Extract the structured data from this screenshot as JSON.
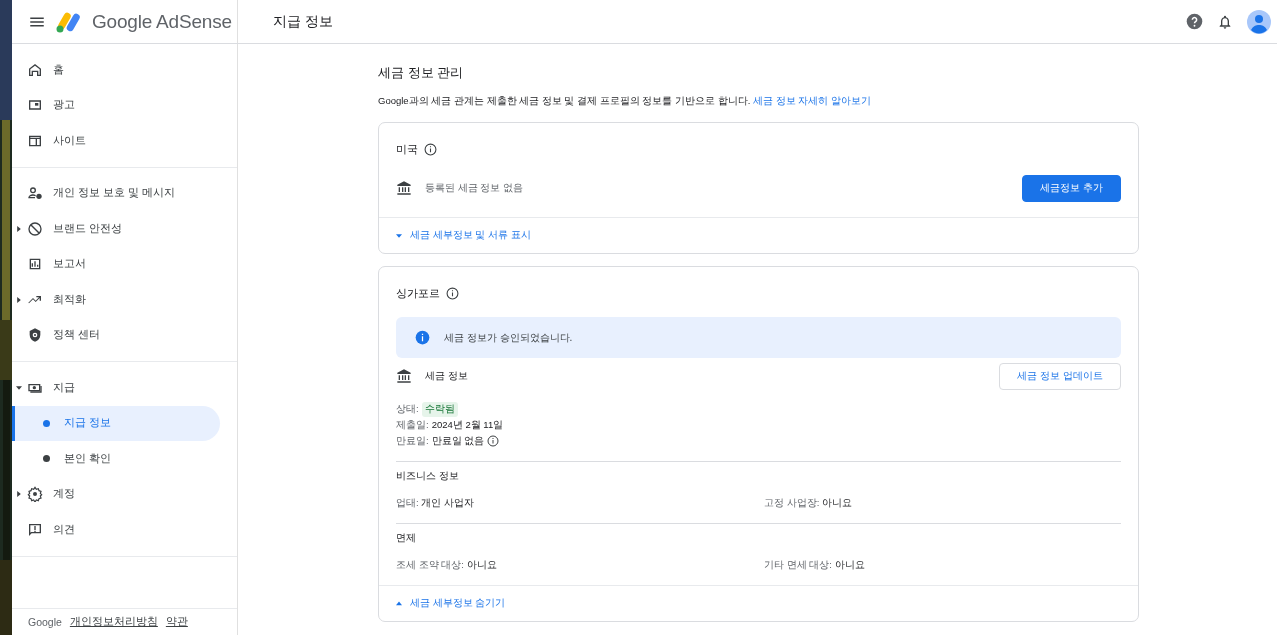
{
  "header": {
    "brand": "Google AdSense",
    "page_title": "지급 정보"
  },
  "sidebar": {
    "sections": [
      [
        {
          "label": "홈",
          "kind": "link"
        },
        {
          "label": "광고",
          "kind": "link"
        },
        {
          "label": "사이트",
          "kind": "link"
        }
      ],
      [
        {
          "label": "개인 정보 보호 및 메시지",
          "kind": "link"
        },
        {
          "label": "브랜드 안전성",
          "kind": "expandable",
          "expanded": false
        },
        {
          "label": "보고서",
          "kind": "link"
        },
        {
          "label": "최적화",
          "kind": "expandable",
          "expanded": false
        },
        {
          "label": "정책 센터",
          "kind": "link"
        }
      ],
      [
        {
          "label": "지급",
          "kind": "expandable",
          "expanded": true,
          "children": [
            {
              "label": "지급 정보",
              "selected": true
            },
            {
              "label": "본인 확인",
              "selected": false
            }
          ]
        },
        {
          "label": "계정",
          "kind": "expandable",
          "expanded": false
        },
        {
          "label": "의견",
          "kind": "link"
        }
      ]
    ],
    "footer": {
      "brand": "Google",
      "links": [
        "개인정보처리방침",
        "약관"
      ]
    }
  },
  "main": {
    "title": "세금 정보 관리",
    "description": "Google과의 세금 관계는 제출한 세금 정보 및 결제 프로필의 정보를 기반으로 합니다.",
    "learn_more": "세금 정보 자세히 알아보기",
    "cards": [
      {
        "country": "미국",
        "info_row": {
          "text": "등록된 세금 정보 없음",
          "emphasis": false
        },
        "button": {
          "label": "세금정보 추가",
          "kind": "primary"
        },
        "toggle": {
          "label": "세금 세부정보 및 서류 표시",
          "expanded": false
        }
      },
      {
        "country": "싱가포르",
        "alert": "세금 정보가 승인되었습니다.",
        "info_row": {
          "text": "세금 정보",
          "emphasis": true
        },
        "button": {
          "label": "세금 정보 업데이트",
          "kind": "outlined"
        },
        "details": [
          {
            "label": "상태:",
            "value": "수락됨",
            "kind": "chip"
          },
          {
            "label": "제출일:",
            "value": "2024년 2월 11일",
            "kind": "text"
          },
          {
            "label": "만료일:",
            "value": "만료일 없음",
            "kind": "info"
          }
        ],
        "sections": [
          {
            "title": "비즈니스 정보",
            "fields": [
              {
                "label": "업태:",
                "value": "개인 사업자"
              },
              {
                "label": "고정 사업장:",
                "value": "아니요"
              }
            ]
          },
          {
            "title": "면제",
            "fields": [
              {
                "label": "조세 조약 대상:",
                "value": "아니요"
              },
              {
                "label": "기타 면세 대상:",
                "value": "아니요"
              }
            ]
          }
        ],
        "toggle": {
          "label": "세금 세부정보 숨기기",
          "expanded": true
        }
      }
    ]
  }
}
